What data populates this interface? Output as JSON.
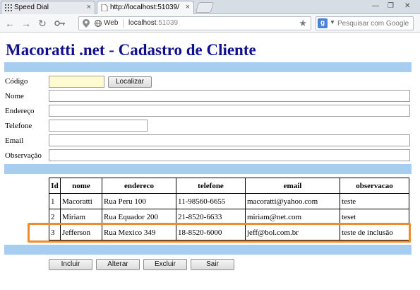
{
  "browser": {
    "tabs": [
      {
        "label": "Speed Dial",
        "active": false
      },
      {
        "label": "http://localhost:51039/",
        "active": true
      }
    ],
    "address": {
      "site_label": "Web",
      "url_host": "localhost",
      "url_port": ":51039"
    },
    "search": {
      "placeholder": "Pesquisar com Google",
      "engine_letter": "g"
    }
  },
  "page": {
    "title": "Macoratti .net - Cadastro de Cliente",
    "form": {
      "codigo": {
        "label": "Código",
        "value": ""
      },
      "localizar_label": "Localizar",
      "nome": {
        "label": "Nome",
        "value": ""
      },
      "endereco": {
        "label": "Endereço",
        "value": ""
      },
      "telefone": {
        "label": "Telefone",
        "value": ""
      },
      "email": {
        "label": "Email",
        "value": ""
      },
      "observacao": {
        "label": "Observação",
        "value": ""
      }
    },
    "table": {
      "columns": [
        "Id",
        "nome",
        "endereco",
        "telefone",
        "email",
        "observacao"
      ],
      "rows": [
        [
          "1",
          "Macoratti",
          "Rua Peru 100",
          "11-98560-6655",
          "macoratti@yahoo.com",
          "teste"
        ],
        [
          "2",
          "Miriam",
          "Rua Equador 200",
          "21-8520-6633",
          "miriam@net.com",
          "teset"
        ],
        [
          "3",
          "Jefferson",
          "Rua Mexico 349",
          "18-8520-6000",
          "jeff@bol.com.br",
          "teste de inclusão"
        ]
      ],
      "highlighted_row": 3
    },
    "actions": {
      "incluir": "Incluir",
      "alterar": "Alterar",
      "excluir": "Excluir",
      "sair": "Sair"
    }
  },
  "colors": {
    "title": "#0f108f",
    "band": "#a7cdf0",
    "codigo_field": "#fffbd0",
    "highlight": "#f18a2b"
  }
}
